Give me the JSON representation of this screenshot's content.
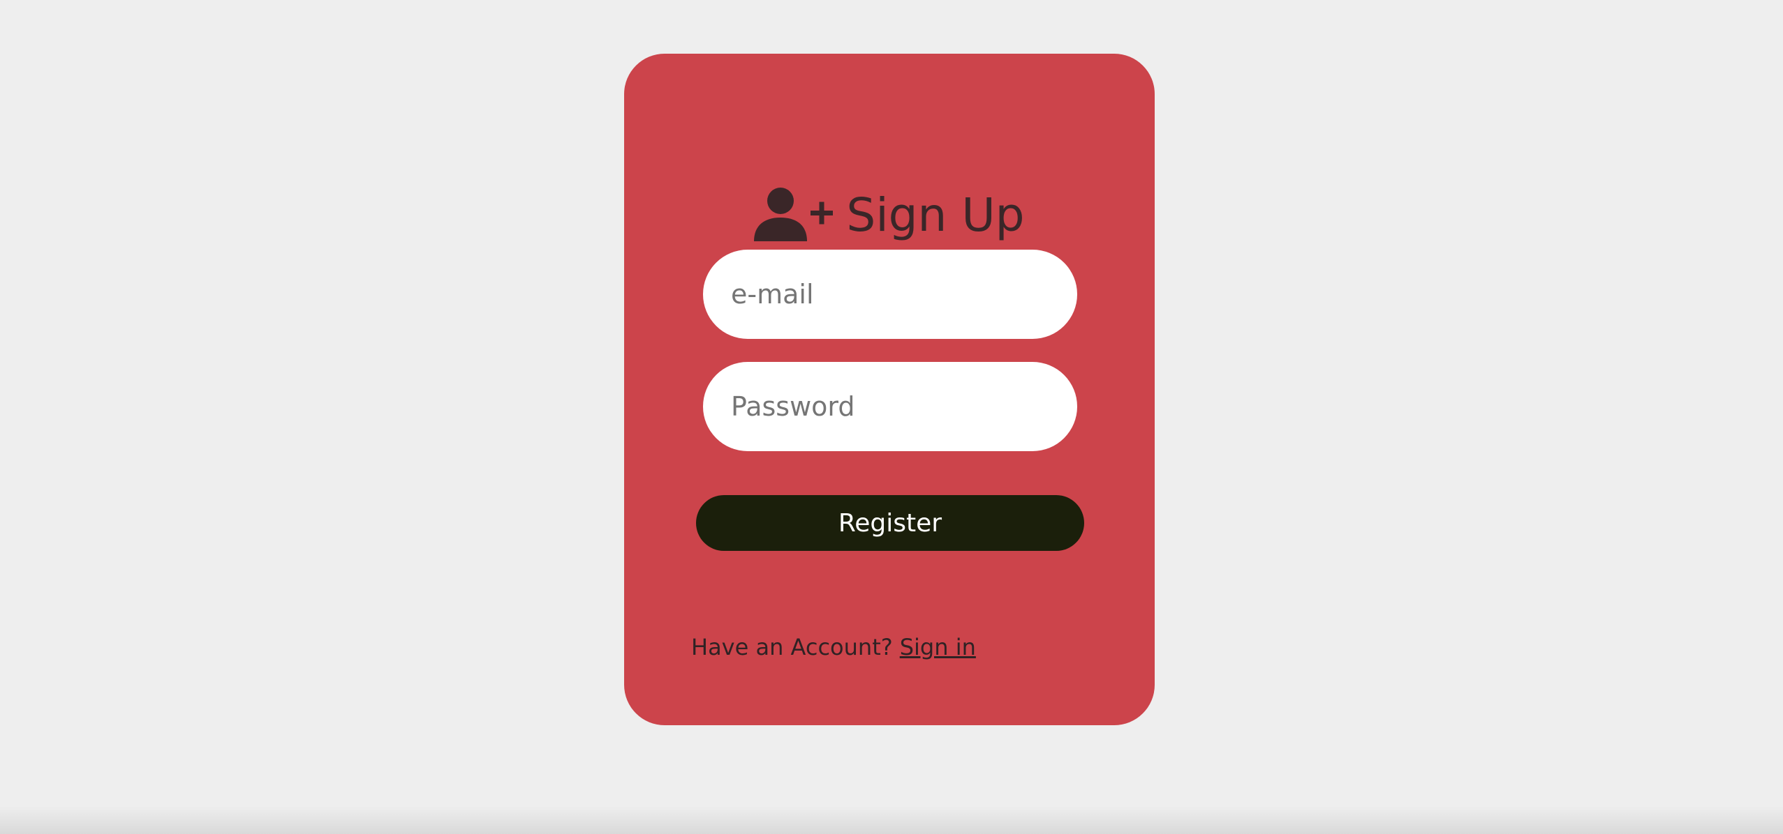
{
  "signup_card": {
    "title": "Sign Up",
    "title_icon": "user-plus-icon",
    "email": {
      "placeholder": "e-mail",
      "value": ""
    },
    "password": {
      "placeholder": "Password",
      "value": ""
    },
    "register_label": "Register",
    "footer": {
      "prompt": "Have an Account?",
      "link_label": "Sign in"
    }
  },
  "colors": {
    "page_background": "#eeeeee",
    "card_background": "#cc444b",
    "title_text": "#3a2628",
    "button_background": "#1b1f0b",
    "button_text": "#ffffff",
    "placeholder_text": "#757575"
  }
}
